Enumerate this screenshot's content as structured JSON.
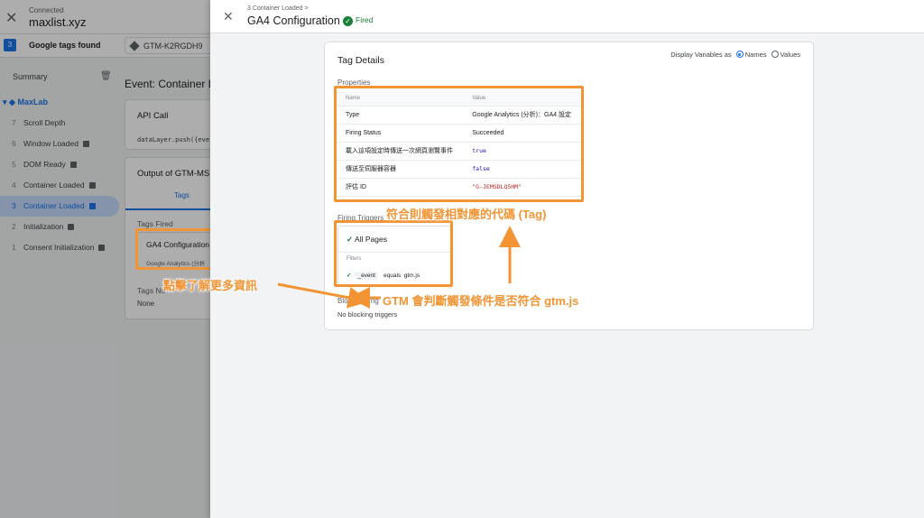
{
  "topbar": {
    "connected": "Connected",
    "site": "maxlist.xyz"
  },
  "secondbar": {
    "count": "3",
    "found_label": "Google tags found",
    "container_id": "GTM-K2RGDH9"
  },
  "sidebar": {
    "summary": "Summary",
    "root": "MaxLab",
    "events": [
      {
        "num": "7",
        "label": "Scroll Depth",
        "badge": false
      },
      {
        "num": "6",
        "label": "Window Loaded",
        "badge": true
      },
      {
        "num": "5",
        "label": "DOM Ready",
        "badge": true
      },
      {
        "num": "4",
        "label": "Container Loaded",
        "badge": true
      },
      {
        "num": "3",
        "label": "Container Loaded",
        "badge": true,
        "active": true
      },
      {
        "num": "2",
        "label": "Initialization",
        "badge": true
      },
      {
        "num": "1",
        "label": "Consent Initialization",
        "badge": true
      }
    ]
  },
  "main": {
    "event_title": "Event: Container L",
    "api_call_title": "API Call",
    "api_call_code": "dataLayer.push({eve",
    "output_title": "Output of GTM-MS",
    "tab_tags": "Tags",
    "tags_fired": "Tags Fired",
    "tag_name": "GA4 Configuration",
    "tag_sub": "Google Analytics (分析",
    "tags_not_fired": "Tags No",
    "none": "None"
  },
  "panel": {
    "breadcrumb": "3 Container Loaded >",
    "title": "GA4 Configuration",
    "status": "Fired",
    "details_title": "Tag Details",
    "display_vars_label": "Display Variables as",
    "opt_names": "Names",
    "opt_values": "Values",
    "properties_label": "Properties",
    "col_name": "Name",
    "col_value": "Value",
    "props": [
      {
        "name": "Type",
        "value": "Google Analytics (分析)：GA4 設定",
        "style": ""
      },
      {
        "name": "Firing Status",
        "value": "Succeeded",
        "style": ""
      },
      {
        "name": "載入這項設定時傳送一次網頁瀏覽事件",
        "value": "true",
        "style": "mono blue"
      },
      {
        "name": "傳送至伺服器容器",
        "value": "false",
        "style": "mono blue"
      },
      {
        "name": "評估 ID",
        "value": "\"G-JEMSDLQ5HM\"",
        "style": "mono red"
      }
    ],
    "firing_triggers_label": "Firing Triggers",
    "trigger_name": "All Pages",
    "filters_label": "Filters",
    "filter_var": "_event",
    "filter_op": "equals",
    "filter_val": "gtm.js",
    "blocking_label": "Blocking Trig",
    "blocking_none": "No blocking triggers"
  },
  "annotations": {
    "a1": "符合則觸發相對應的代碼 (Tag)",
    "a2": "點擊了解更多資訊",
    "a3": "GTM 會判斷觸發條件是否符合 gtm.js",
    "color": "#f29433"
  }
}
